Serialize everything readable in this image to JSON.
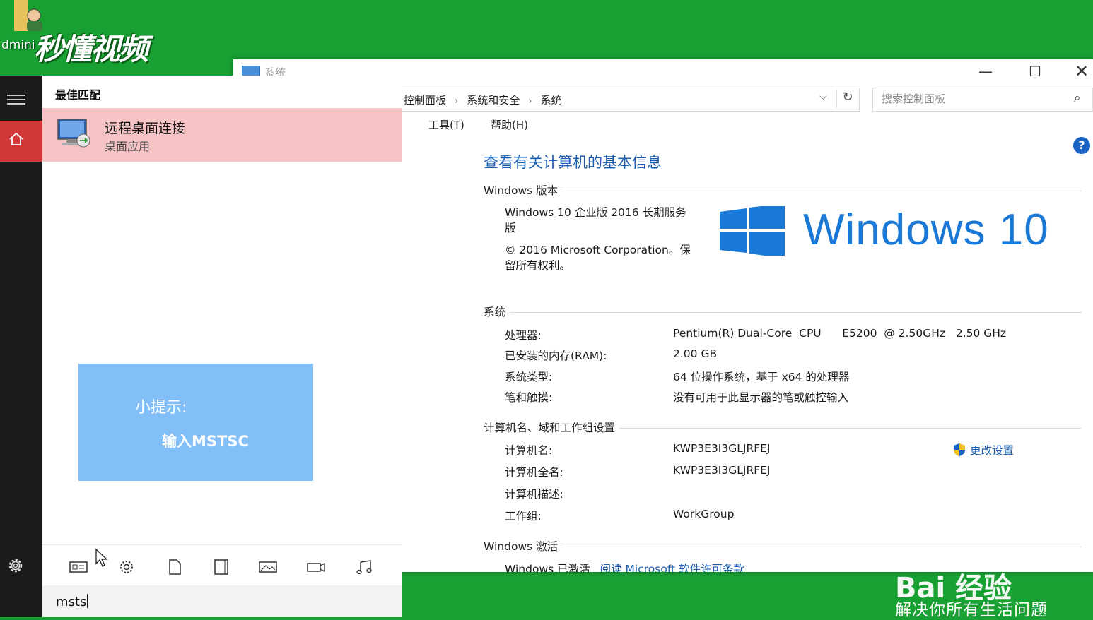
{
  "desktop": {
    "icon_label": "dmini",
    "logo_text": "秒懂视频"
  },
  "control_panel": {
    "window_title": "系统",
    "breadcrumb": [
      "控制面板",
      "系统和安全",
      "系统"
    ],
    "search_placeholder": "搜索控制面板",
    "menu": [
      ")",
      "工具(T)",
      "帮助(H)"
    ],
    "heading": "查看有关计算机的基本信息",
    "edition_section": {
      "title": "Windows 版本",
      "edition": "Windows 10 企业版 2016 长期服务版",
      "copyright": "© 2016 Microsoft Corporation。保留所有权利。",
      "brand": "Windows 10"
    },
    "system_section": {
      "title": "系统",
      "rows": [
        {
          "label": "处理器:",
          "value": "Pentium(R) Dual-Core  CPU      E5200  @ 2.50GHz   2.50 GHz"
        },
        {
          "label": "已安装的内存(RAM):",
          "value": "2.00 GB"
        },
        {
          "label": "系统类型:",
          "value": "64 位操作系统，基于 x64 的处理器"
        },
        {
          "label": "笔和触摸:",
          "value": "没有可用于此显示器的笔或触控输入"
        }
      ]
    },
    "computer_section": {
      "title": "计算机名、域和工作组设置",
      "rows": [
        {
          "label": "计算机名:",
          "value": "KWP3E3I3GLJRFEJ"
        },
        {
          "label": "计算机全名:",
          "value": "KWP3E3I3GLJRFEJ"
        },
        {
          "label": "计算机描述:",
          "value": ""
        },
        {
          "label": "工作组:",
          "value": "WorkGroup"
        }
      ],
      "change_settings": "更改设置"
    },
    "activation_section": {
      "title": "Windows 激活",
      "status": "Windows 已激活",
      "link": "阅读 Microsoft 软件许可条款"
    }
  },
  "watermark": {
    "brand": "Bai 经验",
    "slogan": "解决你所有生活问题"
  },
  "start_menu": {
    "best_match_label": "最佳匹配",
    "result": {
      "name": "远程桌面连接",
      "type": "桌面应用"
    },
    "tip": {
      "title": "小提示:",
      "body": "输入MSTSC"
    },
    "search_text": "msts"
  },
  "colors": {
    "desktop_green": "#18a033",
    "accent_red": "#d23838",
    "result_highlight": "#f7c4c6",
    "tip_blue": "#82bef8",
    "link_blue": "#1a5cb0",
    "windows_blue": "#1a78d6"
  }
}
